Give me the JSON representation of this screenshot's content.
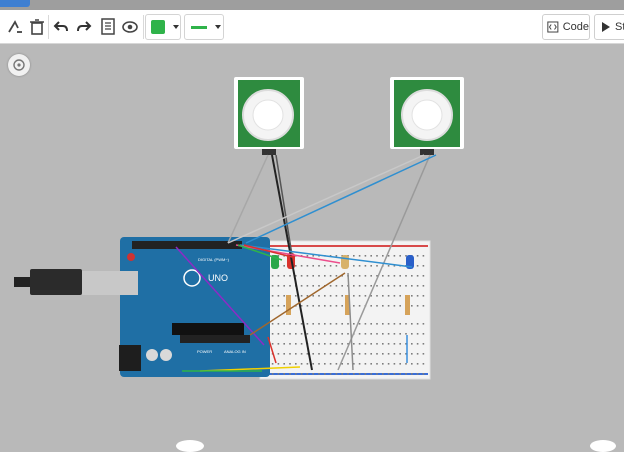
{
  "app": {
    "toolbar": {
      "code_label": "Code",
      "start_label": "St",
      "color_value": "#2fb34a"
    },
    "board": {
      "brand_label": "UNO",
      "digital_label": "DIGITAL (PWM~)",
      "power_label": "POWER",
      "analog_label": "ANALOG IN"
    },
    "icons": [
      "rotate-icon",
      "delete-icon",
      "undo-icon",
      "redo-icon",
      "notes-icon",
      "visibility-icon",
      "code-icon",
      "play-icon",
      "fit-view-icon"
    ]
  }
}
